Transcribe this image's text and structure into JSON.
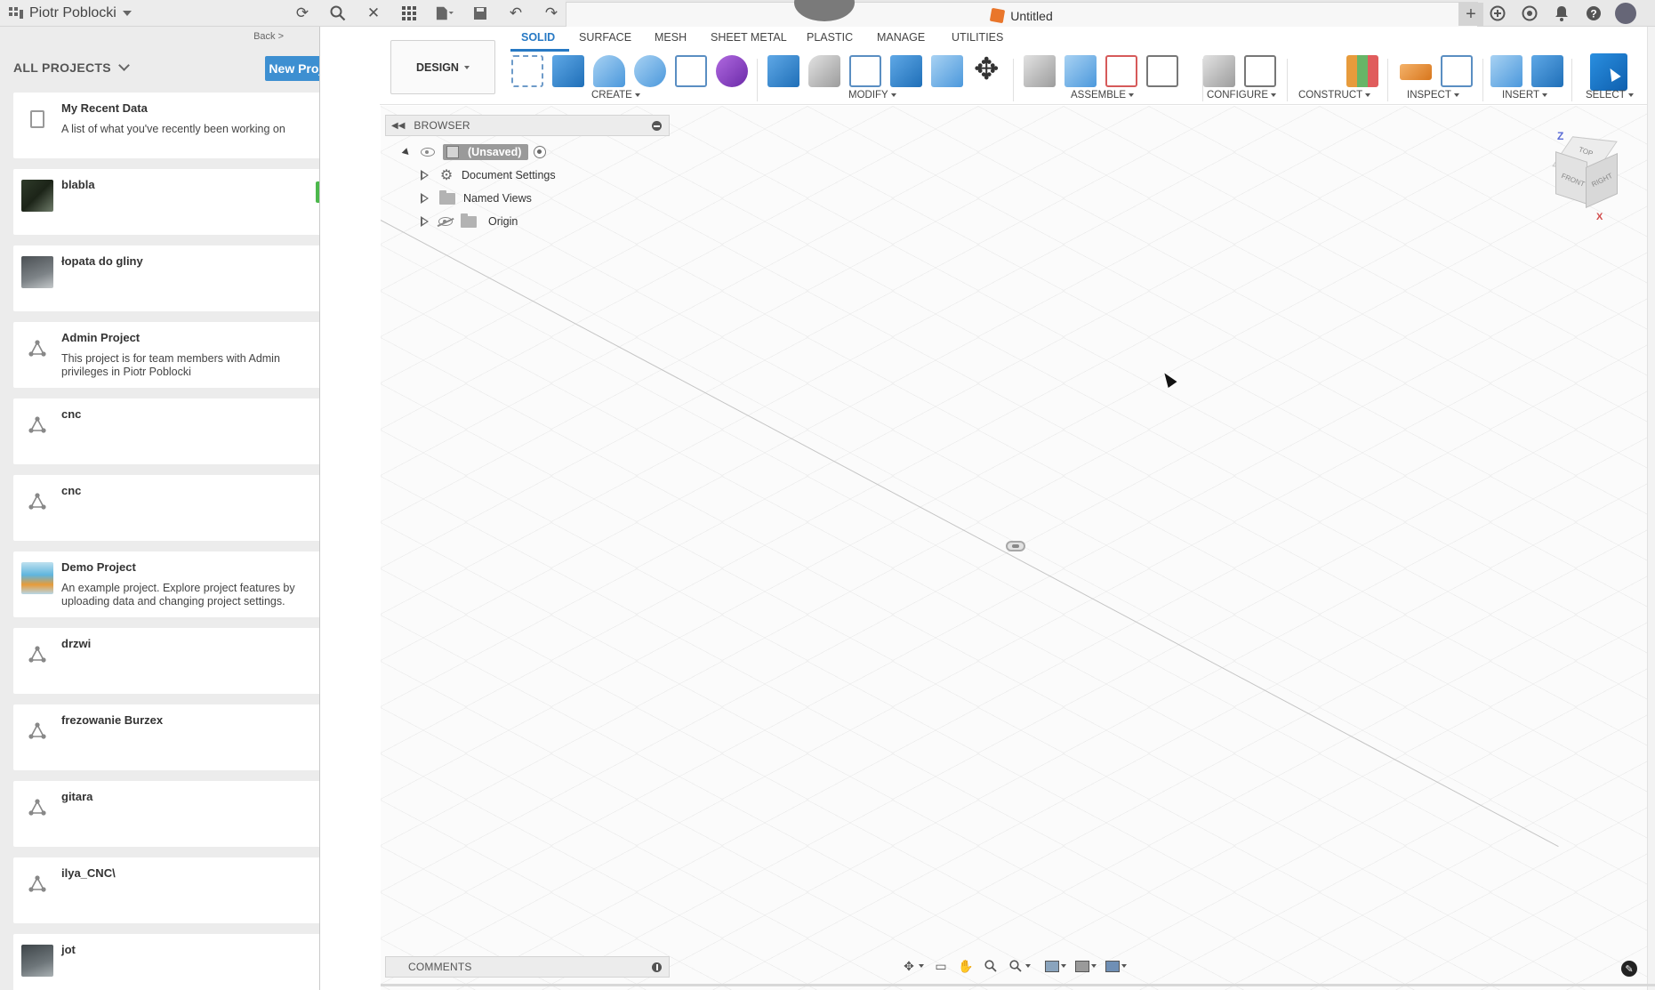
{
  "top_bar": {
    "user_name": "Piotr Poblocki",
    "icons": [
      "refresh-icon",
      "search-icon",
      "close-icon",
      "apps-grid-icon",
      "file-icon",
      "save-icon",
      "undo-icon",
      "redo-icon"
    ]
  },
  "document": {
    "title": "Untitled",
    "icons": [
      "add-tab-icon",
      "extensions-icon",
      "job-status-icon",
      "notifications-icon",
      "help-icon",
      "account-avatar"
    ]
  },
  "left_panel": {
    "back_label": "Back >",
    "heading": "ALL PROJECTS",
    "new_project_label": "New Project",
    "projects": [
      {
        "name": "My Recent Data",
        "description": "A list of what you've recently been working on",
        "thumb": "doc"
      },
      {
        "name": "blabla",
        "description": "",
        "thumb": "img1",
        "starred": true
      },
      {
        "name": "łopata do gliny",
        "description": "",
        "thumb": "img2"
      },
      {
        "name": "Admin Project",
        "description": "This project is for team members with Admin privileges in Piotr Poblocki",
        "thumb": "net"
      },
      {
        "name": "cnc",
        "description": "",
        "thumb": "net"
      },
      {
        "name": "cnc",
        "description": "",
        "thumb": "net"
      },
      {
        "name": "Demo Project",
        "description": "An example project. Explore project features by uploading data and changing project settings.",
        "thumb": "img3"
      },
      {
        "name": "drzwi",
        "description": "",
        "thumb": "net"
      },
      {
        "name": "frezowanie Burzex",
        "description": "",
        "thumb": "net"
      },
      {
        "name": "gitara",
        "description": "",
        "thumb": "net"
      },
      {
        "name": "ilya_CNC\\",
        "description": "",
        "thumb": "net"
      },
      {
        "name": "jot",
        "description": "",
        "thumb": "img4"
      }
    ]
  },
  "toolbar": {
    "workspace": "DESIGN",
    "tabs": [
      "SOLID",
      "SURFACE",
      "MESH",
      "SHEET METAL",
      "PLASTIC",
      "MANAGE",
      "UTILITIES"
    ],
    "active_tab": "SOLID",
    "groups": {
      "create": "CREATE",
      "modify": "MODIFY",
      "assemble": "ASSEMBLE",
      "configure": "CONFIGURE",
      "construct": "CONSTRUCT",
      "inspect": "INSPECT",
      "insert": "INSERT",
      "select": "SELECT"
    }
  },
  "browser": {
    "title": "BROWSER",
    "root": "(Unsaved)",
    "items": [
      "Document Settings",
      "Named Views",
      "Origin"
    ]
  },
  "comments": {
    "title": "COMMENTS"
  },
  "viewcube": {
    "top": "TOP",
    "front": "FRONT",
    "right": "RIGHT",
    "z_axis": "Z",
    "x_axis": "X"
  },
  "colors": {
    "accent": "#2779c4",
    "new_project_button": "#3d8fd1",
    "star_badge": "#4cb84c",
    "doc_icon": "#e9762b"
  }
}
